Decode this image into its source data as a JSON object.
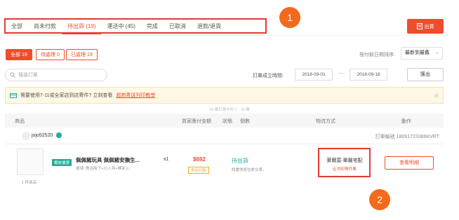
{
  "tabs": [
    {
      "label": "全部"
    },
    {
      "label": "尚未付款"
    },
    {
      "label": "待出貨 (19)"
    },
    {
      "label": "運送中 (45)"
    },
    {
      "label": "完成"
    },
    {
      "label": "已取消"
    },
    {
      "label": "退款/退貨"
    }
  ],
  "callouts": {
    "one": "1",
    "two": "2"
  },
  "ship_button": {
    "label": "出貨",
    "icon": "document-icon"
  },
  "filters": {
    "all": "全部 19",
    "pending": "待處理 0",
    "processed": "已處理 19"
  },
  "sort": {
    "label": "按付款日期排序:",
    "value": "最新到最舊"
  },
  "search": {
    "placeholder": "搜尋訂單"
  },
  "date_range": {
    "label": "訂單成立時間:",
    "from": "2018-09-01",
    "to": "2018-09-18"
  },
  "export_button": {
    "label": "匯出"
  },
  "notice": {
    "text": "需要使用7-11或全家店到店寄件? 立刻查看",
    "link": "超商寄送列印教學"
  },
  "page_info": "19 筆訂單中的 1 - 19 筆",
  "table_headers": {
    "product": "商品",
    "buyer_total": "買家應付金額",
    "status": "狀態",
    "countdown": "倒數",
    "shipping": "物流方式",
    "action": "動作"
  },
  "order": {
    "buyer": "jojo52520",
    "order_no": "訂單編號 18091723386KVRT",
    "tag": "蝦皮優選",
    "product_name": "佩佩豬玩具 佩佩豬安撫生...",
    "variant": "選項: 喬治兩子+21入特+課架 jt...",
    "qty": "x1",
    "price": "$692",
    "payment": "貨到付款",
    "status": "待出貨",
    "status_sub": "請盡快將包裹交寄。",
    "shipping_method": "萊爾富-單層宅配",
    "print_label": "列印寄件單",
    "view_button": "查看明細",
    "items_count": "1 件商品"
  },
  "colors": {
    "accent": "#ee4d2d",
    "highlight": "#e53935",
    "callout": "#f36a1d",
    "status": "#26aa99"
  }
}
